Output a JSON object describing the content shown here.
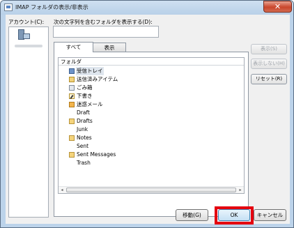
{
  "window": {
    "title": "IMAP フォルダの表示/非表示",
    "close_glyph": "✕"
  },
  "accounts": {
    "label": "アカウント(C):"
  },
  "filter": {
    "label": "次の文字列を含むフォルダを表示する(D):",
    "value": "",
    "placeholder": ""
  },
  "tabs": [
    {
      "label": "すべて",
      "selected": true
    },
    {
      "label": "表示",
      "selected": false
    }
  ],
  "folder_list": {
    "header": "フォルダ",
    "rows": [
      {
        "label": "受信トレイ",
        "icon": "inbox-icon",
        "selected": true
      },
      {
        "label": "送信済みアイテム",
        "icon": "sent-items-icon"
      },
      {
        "label": "ごみ箱",
        "icon": "trash-icon"
      },
      {
        "label": "下書き",
        "icon": "drafts-icon"
      },
      {
        "label": "迷惑メール",
        "icon": "junk-icon"
      },
      {
        "label": "Draft",
        "icon": null
      },
      {
        "label": "Drafts",
        "icon": "folder-icon"
      },
      {
        "label": "Junk",
        "icon": null
      },
      {
        "label": "Notes",
        "icon": "folder-icon"
      },
      {
        "label": "Sent",
        "icon": null
      },
      {
        "label": "Sent Messages",
        "icon": "folder-icon"
      },
      {
        "label": "Trash",
        "icon": null
      }
    ],
    "scroll_left": "◂",
    "scroll_right": "▸"
  },
  "side_buttons": {
    "show": "表示(S)",
    "hide": "表示しない(H)",
    "reset": "リセット(R)"
  },
  "footer_buttons": {
    "move": "移動(G)",
    "ok": "OK",
    "cancel": "キャンセル"
  },
  "colors": {
    "title_bar": "#bcd3ea",
    "highlight": "#e4000f",
    "selected_row": "#dfe6ee"
  }
}
